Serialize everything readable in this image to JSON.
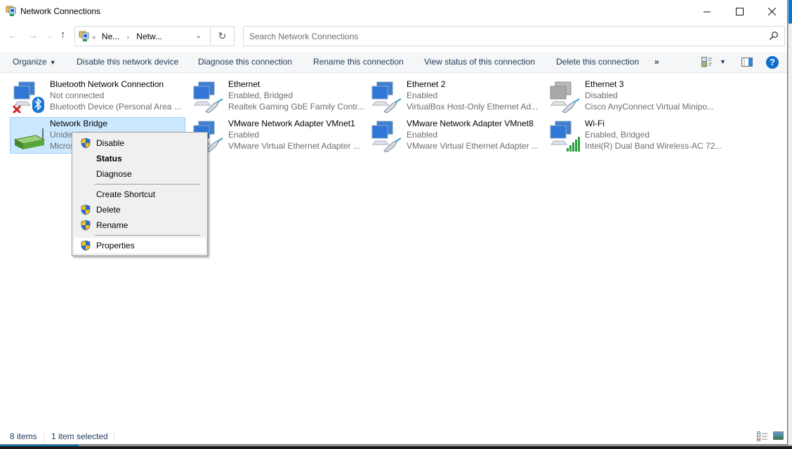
{
  "window": {
    "title": "Network Connections",
    "controls": {
      "minimize": "—",
      "maximize": "☐",
      "close": "✕"
    }
  },
  "nav": {
    "back": "←",
    "forward": "→",
    "recent": "⌄",
    "up": "↑",
    "refresh": "↻"
  },
  "address": {
    "overflow": "«",
    "crumbs": [
      "Ne...",
      "Netw..."
    ],
    "separator": "›",
    "dropdown": "⌄"
  },
  "search": {
    "placeholder": "Search Network Connections",
    "value": ""
  },
  "commandbar": {
    "organize": "Organize",
    "disable": "Disable this network device",
    "diagnose": "Diagnose this connection",
    "rename": "Rename this connection",
    "view_status": "View status of this connection",
    "delete": "Delete this connection",
    "more": "»",
    "help": "?"
  },
  "connections": [
    {
      "name": "Bluetooth Network Connection",
      "status": "Not connected",
      "device": "Bluetooth Device (Personal Area ...",
      "icon": "bluetooth-network-icon",
      "selected": false
    },
    {
      "name": "Ethernet",
      "status": "Enabled, Bridged",
      "device": "Realtek Gaming GbE Family Contr...",
      "icon": "ethernet-icon",
      "selected": false
    },
    {
      "name": "Ethernet 2",
      "status": "Enabled",
      "device": "VirtualBox Host-Only Ethernet Ad...",
      "icon": "ethernet-icon",
      "selected": false
    },
    {
      "name": "Ethernet 3",
      "status": "Disabled",
      "device": "Cisco AnyConnect Virtual Minipo...",
      "icon": "ethernet-disabled-icon",
      "selected": false
    },
    {
      "name": "Network Bridge",
      "status": "Unidentified network",
      "device": "Microsoft Network Adapter Multiplexor Driver",
      "icon": "network-bridge-icon",
      "selected": true
    },
    {
      "name": "VMware Network Adapter VMnet1",
      "status": "Enabled",
      "device": "VMware Virtual Ethernet Adapter ...",
      "icon": "ethernet-icon",
      "selected": false
    },
    {
      "name": "VMware Network Adapter VMnet8",
      "status": "Enabled",
      "device": "VMware Virtual Ethernet Adapter ...",
      "icon": "ethernet-icon",
      "selected": false
    },
    {
      "name": "Wi-Fi",
      "status": "Enabled, Bridged",
      "device": "Intel(R) Dual Band Wireless-AC 72...",
      "icon": "wifi-adapter-icon",
      "selected": false
    }
  ],
  "context_menu": {
    "items": [
      {
        "label": "Disable",
        "shield": true,
        "bold": false
      },
      {
        "label": "Status",
        "shield": false,
        "bold": true
      },
      {
        "label": "Diagnose",
        "shield": false,
        "bold": false
      },
      {
        "label": "Create Shortcut",
        "shield": false,
        "bold": false
      },
      {
        "label": "Delete",
        "shield": true,
        "bold": false
      },
      {
        "label": "Rename",
        "shield": true,
        "bold": false
      },
      {
        "label": "Properties",
        "shield": true,
        "bold": false,
        "highlighted": true
      }
    ]
  },
  "statusbar": {
    "item_count": "8 items",
    "selection": "1 item selected"
  }
}
